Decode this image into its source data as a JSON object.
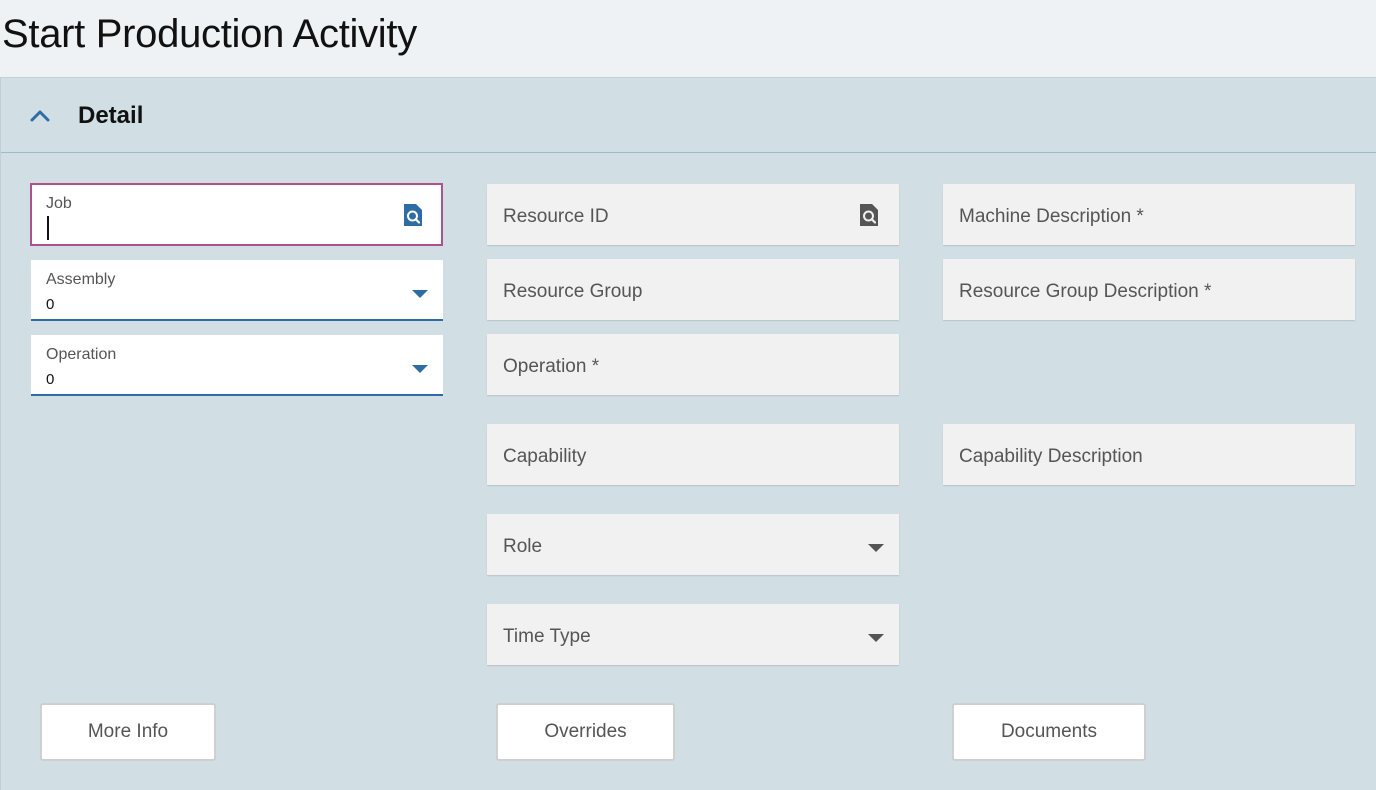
{
  "page": {
    "title": "Start Production Activity"
  },
  "section": {
    "title": "Detail",
    "toggle_icon": "chevron-up-icon"
  },
  "left_column": {
    "job": {
      "label": "Job",
      "value": "",
      "icon": "search-document-icon"
    },
    "assembly": {
      "label": "Assembly",
      "value": "0",
      "icon": "dropdown-arrow-icon"
    },
    "operation": {
      "label": "Operation",
      "value": "0",
      "icon": "dropdown-arrow-icon"
    }
  },
  "middle_column": {
    "resource_id": {
      "label": "Resource ID",
      "icon": "search-document-icon"
    },
    "resource_group": {
      "label": "Resource Group"
    },
    "operation": {
      "label": "Operation *"
    },
    "capability": {
      "label": "Capability"
    },
    "role": {
      "label": "Role",
      "icon": "dropdown-arrow-icon"
    },
    "time_type": {
      "label": "Time Type",
      "icon": "dropdown-arrow-icon"
    }
  },
  "right_column": {
    "machine_description": {
      "label": "Machine Description *"
    },
    "resource_group_description": {
      "label": "Resource Group Description *"
    },
    "capability_description": {
      "label": "Capability Description"
    }
  },
  "buttons": {
    "more_info": "More Info",
    "overrides": "Overrides",
    "documents": "Documents"
  },
  "colors": {
    "accent_blue": "#2d6da3",
    "focus_border": "#b0508e",
    "panel_bg": "#d1dee3",
    "header_bg": "#eef2f5"
  }
}
